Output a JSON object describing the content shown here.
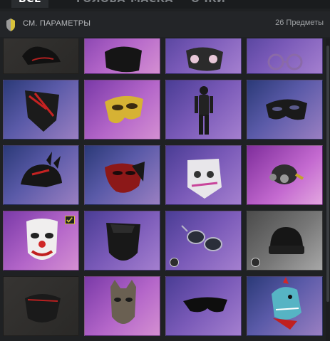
{
  "tabs": [
    {
      "label": "ВСЁ",
      "active": true
    },
    {
      "label": "ГОЛОВА",
      "active": false
    },
    {
      "label": "МАСКА",
      "active": false
    },
    {
      "label": "ОЧКИ",
      "active": false
    }
  ],
  "filter": {
    "label": "СМ. ПАРАМЕТРЫ",
    "icon": "filter-icon"
  },
  "item_count": "26 Предметы",
  "colors": {
    "accent": "#d8c23a",
    "background": "#1f2123"
  },
  "items": [
    {
      "id": "cap-black",
      "icon": "cap-icon",
      "rarity": "dark"
    },
    {
      "id": "bandana-black",
      "icon": "bandana-icon",
      "rarity": "purple"
    },
    {
      "id": "cat-mask-cartoon",
      "icon": "cartoon-mask-icon",
      "rarity": "violet"
    },
    {
      "id": "round-glasses",
      "icon": "glasses-icon",
      "rarity": "violet"
    },
    {
      "id": "face-wrap-red",
      "icon": "face-wrap-icon",
      "rarity": "blue"
    },
    {
      "id": "gold-half-mask",
      "icon": "gold-mask-icon",
      "rarity": "purple"
    },
    {
      "id": "outfit-black",
      "icon": "outfit-icon",
      "rarity": "violet"
    },
    {
      "id": "eye-mask-black",
      "icon": "eye-mask-icon",
      "rarity": "blue"
    },
    {
      "id": "devil-cap",
      "icon": "devil-cap-icon",
      "rarity": "blue"
    },
    {
      "id": "red-half-mask",
      "icon": "red-mask-icon",
      "rarity": "blue"
    },
    {
      "id": "cyber-mask",
      "icon": "cyber-mask-icon",
      "rarity": "violet"
    },
    {
      "id": "gas-mask",
      "icon": "gas-mask-icon",
      "rarity": "pink"
    },
    {
      "id": "clown-mask",
      "icon": "clown-mask-icon",
      "rarity": "purple",
      "equipped": true
    },
    {
      "id": "face-cover-black",
      "icon": "face-cover-icon",
      "rarity": "violet"
    },
    {
      "id": "aviator-glasses",
      "icon": "aviator-icon",
      "rarity": "violet",
      "timed": true
    },
    {
      "id": "beanie-black",
      "icon": "beanie-icon",
      "rarity": "grey",
      "timed": true
    },
    {
      "id": "cloth-mask-black",
      "icon": "cloth-mask-icon",
      "rarity": "dark"
    },
    {
      "id": "wolf-mask",
      "icon": "wolf-mask-icon",
      "rarity": "purple"
    },
    {
      "id": "sport-glasses",
      "icon": "sport-glasses-icon",
      "rarity": "violet"
    },
    {
      "id": "dino-head",
      "icon": "dino-head-icon",
      "rarity": "blue"
    }
  ]
}
